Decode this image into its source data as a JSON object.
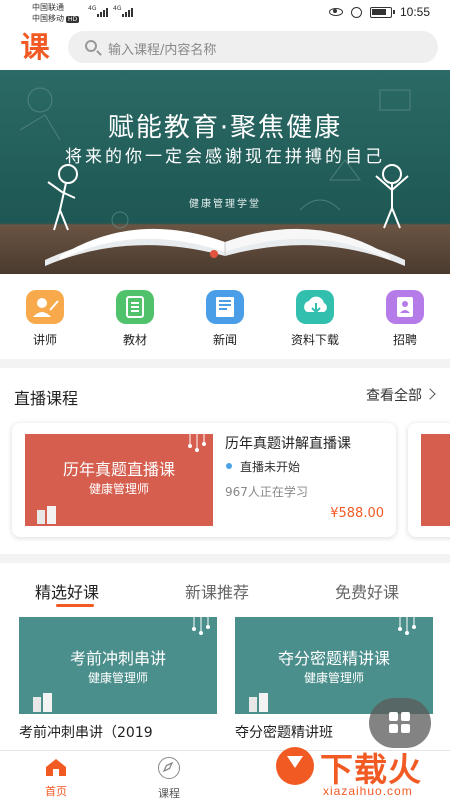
{
  "status_bar": {
    "carrier1": "中国联通",
    "carrier2": "中国移动",
    "hd_badge": "HD",
    "network1": "4G",
    "network2": "4G",
    "time": "10:55"
  },
  "header": {
    "logo_text": "课",
    "search_placeholder": "输入课程/内容名称"
  },
  "banner": {
    "title": "赋能教育·聚焦健康",
    "subtitle": "将来的你一定会感谢现在拼搏的自己",
    "caption": "健康管理学堂"
  },
  "nav_items": [
    {
      "label": "讲师",
      "icon": "teacher-icon",
      "color": "#f7a94b"
    },
    {
      "label": "教材",
      "icon": "textbook-icon",
      "color": "#4fc26b"
    },
    {
      "label": "新闻",
      "icon": "news-icon",
      "color": "#4a9ee8"
    },
    {
      "label": "资料下载",
      "icon": "download-icon",
      "color": "#33bfae"
    },
    {
      "label": "招聘",
      "icon": "recruit-icon",
      "color": "#b57be8"
    }
  ],
  "live_section": {
    "title": "直播课程",
    "see_all": "查看全部",
    "card": {
      "thumb_title": "历年真题直播课",
      "thumb_sub": "健康管理师",
      "name": "历年真题讲解直播课",
      "status": "直播未开始",
      "viewers": "967人正在学习",
      "price": "¥588.00"
    }
  },
  "course_tabs": [
    "精选好课",
    "新课推荐",
    "免费好课"
  ],
  "active_tab": 0,
  "courses": [
    {
      "thumb_title": "考前冲刺串讲",
      "thumb_sub": "健康管理师",
      "name": "考前冲刺串讲（2019"
    },
    {
      "thumb_title": "夺分密题精讲课",
      "thumb_sub": "健康管理师",
      "name": "夺分密题精讲班"
    }
  ],
  "bottom_nav": [
    {
      "label": "首页",
      "icon": "home-icon",
      "active": true
    },
    {
      "label": "课程",
      "icon": "compass-icon",
      "active": false
    }
  ],
  "watermark": {
    "title": "下载火",
    "url": "xiazaihuo.com"
  },
  "colors": {
    "accent": "#f25a24",
    "banner_bg": "#1e5753",
    "live_thumb": "#d65e4e",
    "course_thumb": "#4b8f8c"
  }
}
